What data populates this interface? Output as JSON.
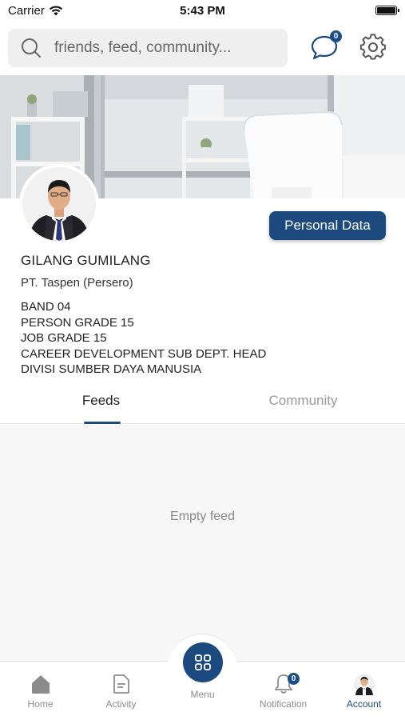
{
  "status_bar": {
    "carrier": "Carrier",
    "time": "5:43 PM"
  },
  "header": {
    "search_placeholder": "friends, feed, community...",
    "chat_badge": "0"
  },
  "profile": {
    "personal_data_button": "Personal Data",
    "name": "GILANG GUMILANG",
    "company": "PT. Taspen (Persero)",
    "details": [
      "BAND 04",
      "PERSON GRADE 15",
      "JOB GRADE 15",
      "CAREER DEVELOPMENT SUB DEPT. HEAD",
      "DIVISI SUMBER DAYA MANUSIA"
    ]
  },
  "tabs": {
    "feeds": "Feeds",
    "community": "Community",
    "active": "Feeds"
  },
  "feed": {
    "empty_text": "Empty feed"
  },
  "bottom_nav": {
    "home": "Home",
    "activity": "Activity",
    "menu": "Menu",
    "notification": "Notification",
    "notification_badge": "0",
    "account": "Account",
    "active": "Account"
  },
  "colors": {
    "primary": "#1c4a7e",
    "badge": "#1c4f8a",
    "inactive": "#8c8c8c"
  }
}
